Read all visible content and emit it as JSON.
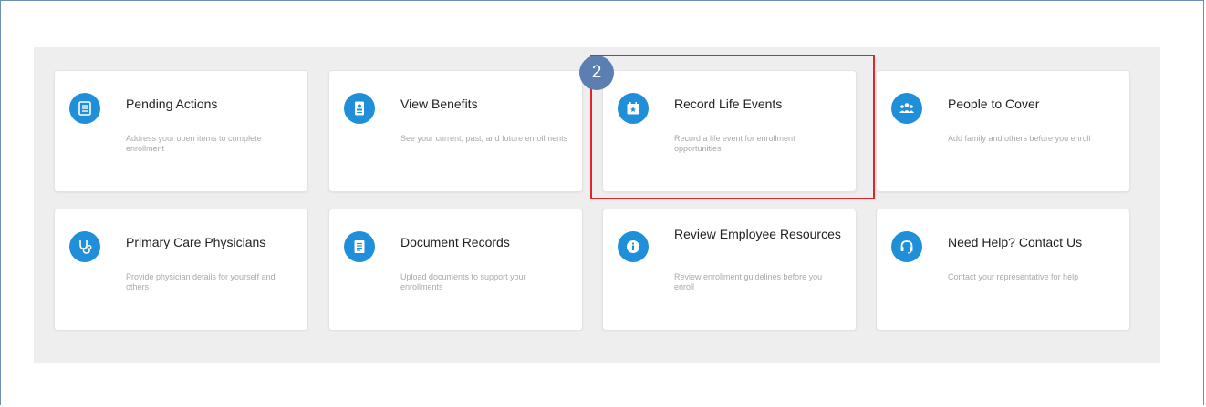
{
  "tiles": [
    {
      "title": "Pending Actions",
      "desc": "Address your open items to complete enrollment",
      "icon": "checklist-icon"
    },
    {
      "title": "View Benefits",
      "desc": "See your current, past, and future enrollments",
      "icon": "id-card-icon"
    },
    {
      "title": "Record Life Events",
      "desc": "Record a life event for enrollment opportunities",
      "icon": "calendar-star-icon"
    },
    {
      "title": "People to Cover",
      "desc": "Add family and others before you enroll",
      "icon": "people-icon"
    },
    {
      "title": "Primary Care Physicians",
      "desc": "Provide physician details for yourself and others",
      "icon": "stethoscope-icon"
    },
    {
      "title": "Document Records",
      "desc": "Upload documents to support your enrollments",
      "icon": "document-icon"
    },
    {
      "title": "Review Employee Resources",
      "desc": "Review enrollment guidelines before you enroll",
      "icon": "info-icon"
    },
    {
      "title": "Need Help? Contact Us",
      "desc": "Contact your representative for help",
      "icon": "headset-icon"
    }
  ],
  "callout": {
    "step": "2",
    "highlighted_tile": "Record Life Events"
  },
  "colors": {
    "accent": "#1f8fda",
    "highlight": "#e2232a",
    "badge": "#5b7fb0",
    "panel": "#eeeeee"
  }
}
